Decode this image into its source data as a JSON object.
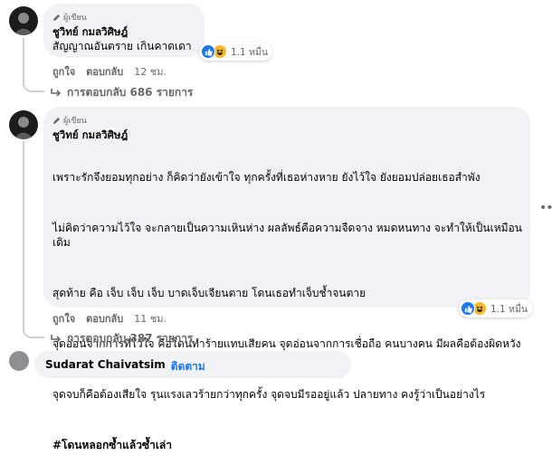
{
  "comments": [
    {
      "badge": "ผู้เขียน",
      "author": "ชูวิทย์ กมลวิศิษฎ์",
      "text": "สัญญาณอันตราย เกินคาดเดา",
      "reaction_count": "1.1 หมื่น",
      "like_label": "ถูกใจ",
      "reply_label": "ตอบกลับ",
      "time": "12 ชม.",
      "replies_label": "การตอบกลับ 686 รายการ"
    },
    {
      "badge": "ผู้เขียน",
      "author": "ชูวิทย์ กมลวิศิษฎ์",
      "paragraphs": [
        "เพราะรักจึงยอมทุกอย่าง ก็คิดว่ายังเข้าใจ ทุกครั้งที่เธอห่างหาย ยังไว้ใจ ยังยอมปล่อยเธอสำพัง",
        "ไม่คิดว่าความไว้ใจ จะกลายเป็นความเหินห่าง ผลลัพธ์คือความจืดจาง หมดหนทาง จะทำให้เป็นเหมือนเดิม",
        "สุดท้าย คือ เจ็บ เจ็บ เจ็บ บาดเจ็บเจียนตาย โดนเธอทำเจ็บช้ำจนตาย",
        "จุดอ่อนจากการที่ไว้ใจ คือโดนทำร้ายแทบเสียคน จุดอ่อนจากการเชื่อถือ คนบางคน มีผลคือต้องผิดหวัง",
        "จุดจบก็คือต้องเสียใจ รุนแรงเลวร้ายกว่าทุกครั้ง จุดจบมีรออยู่แล้ว ปลายทาง คงรู้ว่าเป็นอย่างไร"
      ],
      "hashtag": "#โดนหลอกซ้ำแล้วซ้ำเล่า",
      "reaction_count": "1.1 หมื่น",
      "like_label": "ถูกใจ",
      "reply_label": "ตอบกลับ",
      "time": "11 ชม.",
      "replies_label": "การตอบกลับ 387 รายการ"
    }
  ],
  "partial_comment": {
    "author": "Sudarat Chaivatsim",
    "follow_label": "ติดตาม"
  },
  "colors": {
    "bubble": "#f0f2f5",
    "secondary_text": "#65676b",
    "like_blue": "#1877f2",
    "haha_yellow": "#f7b928"
  },
  "icons": [
    "pen-icon",
    "like-reaction-icon",
    "haha-reaction-icon",
    "reply-arrow-icon",
    "more-options-icon"
  ]
}
